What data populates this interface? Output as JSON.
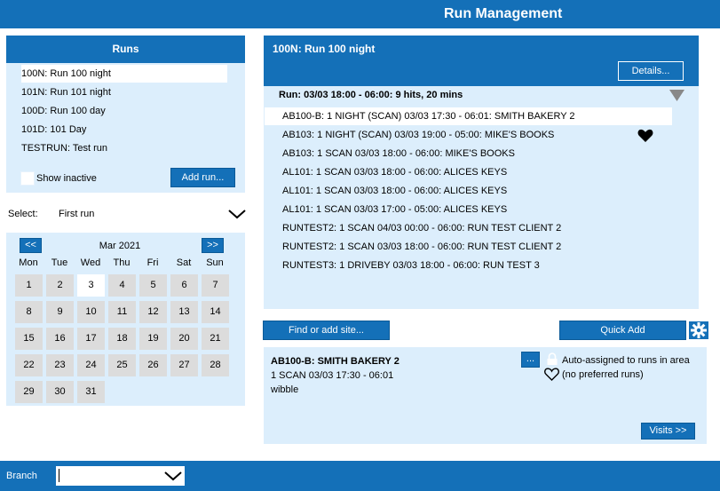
{
  "app": {
    "title": "Run Management"
  },
  "runs": {
    "header": "Runs",
    "items": [
      {
        "label": "100N: Run 100 night",
        "selected": true
      },
      {
        "label": "101N: Run 101 night",
        "selected": false
      },
      {
        "label": "100D: Run 100 day",
        "selected": false
      },
      {
        "label": "101D: 101 Day",
        "selected": false
      },
      {
        "label": "TESTRUN: Test run",
        "selected": false
      }
    ],
    "show_inactive_label": "Show inactive",
    "add_run_label": "Add run..."
  },
  "select": {
    "label": "Select:",
    "value": "First run"
  },
  "calendar": {
    "prev_label": "<<",
    "next_label": ">>",
    "month_label": "Mar 2021",
    "weekdays": [
      "Mon",
      "Tue",
      "Wed",
      "Thu",
      "Fri",
      "Sat",
      "Sun"
    ],
    "days": [
      "1",
      "2",
      "3",
      "4",
      "5",
      "6",
      "7",
      "8",
      "9",
      "10",
      "11",
      "12",
      "13",
      "14",
      "15",
      "16",
      "17",
      "18",
      "19",
      "20",
      "21",
      "22",
      "23",
      "24",
      "25",
      "26",
      "27",
      "28",
      "29",
      "30",
      "31"
    ],
    "today": "3"
  },
  "run_panel": {
    "title": "100N: Run 100 night",
    "details_label": "Details...",
    "summary": "Run: 03/03 18:00 - 06:00: 9 hits, 20 mins",
    "lines": [
      "AB100-B: 1 NIGHT (SCAN) 03/03 17:30 - 06:01: SMITH BAKERY 2",
      "AB103: 1 NIGHT (SCAN) 03/03 19:00 - 05:00: MIKE'S BOOKS",
      "AB103: 1 SCAN 03/03 18:00 - 06:00: MIKE'S BOOKS",
      "AL101: 1 SCAN 03/03 18:00 - 06:00: ALICES KEYS",
      "AL101: 1 SCAN 03/03 18:00 - 06:00: ALICES KEYS",
      "AL101: 1 SCAN 03/03 17:00 - 05:00: ALICES KEYS",
      "RUNTEST2: 1 SCAN 04/03 00:00 - 06:00: RUN TEST CLIENT 2",
      "RUNTEST2: 1 SCAN 03/03 18:00 - 06:00: RUN TEST CLIENT 2",
      "RUNTEST3: 1 DRIVEBY 03/03 18:00 - 06:00: RUN TEST 3"
    ]
  },
  "actions": {
    "find_site_label": "Find or add site...",
    "quick_add_label": "Quick Add"
  },
  "detail": {
    "title": "AB100-B: SMITH BAKERY 2",
    "line1": "1 SCAN 03/03 17:30 - 06:01",
    "line2": "wibble",
    "more_label": "...",
    "auto_assigned": "Auto-assigned to runs in area",
    "preferred": "(no preferred runs)",
    "visits_label": "Visits >>"
  },
  "branch": {
    "label": "Branch",
    "value": ""
  },
  "colors": {
    "accent": "#1470b8",
    "panel": "#dceefc",
    "day": "#dcdcdc"
  }
}
